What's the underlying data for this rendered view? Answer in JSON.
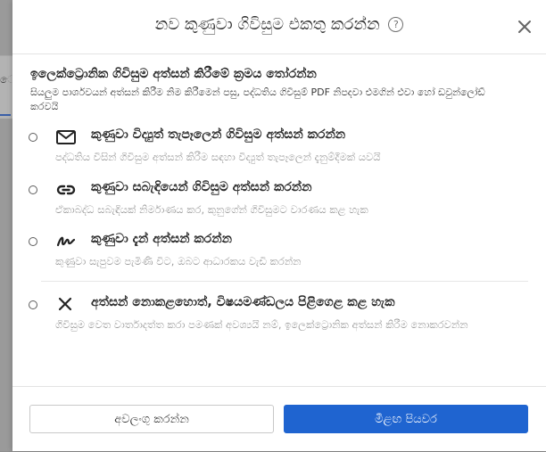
{
  "background": {
    "partial_mark": "ෙ"
  },
  "dialog": {
    "title": "නව කුණුවා ගිවිසුම එකතු කරන්න",
    "help_symbol": "?",
    "section": {
      "title": "ඉලෙක්ට්‍රොනික ගිවිසුම අත්සන් කිරීමේ ක්‍රමය තෝරන්න",
      "description": "සියලුම පාර්ශවයන් අත්සන් කිරීම නිම කිරීමෙන් පසු, පද්ධතිය ගිවිසුම් PDF නිපදවා එමගින් එවා හෝ ඩවුන්ලෝඩ් කරවයි"
    },
    "options": [
      {
        "icon": "envelope-icon",
        "label": "කුණුවා විද්‍යුත් තැපෑලෙන් ගිවිසුම අත්සන් කරන්න",
        "description": "පද්ධතිය විසින් ගිවිසුම අත්සන් කිරීම සඳහා විද්‍යුත් තැපෑලෙන් දැනුම්දීමක් යවයි"
      },
      {
        "icon": "link-icon",
        "label": "කුණුවා සබැඳියෙන් ගිවිසුම අත්සන් කරන්න",
        "description": "ඒකාබද්ධ සබැඳියක් නිර්මාණය කර, කුනුගේන් ගිවිසුමට වාරණය කළ හැක"
      },
      {
        "icon": "signature-icon",
        "label": "කුණුවා දැන් අත්සන් කරන්න",
        "description": "කුණුවා සැපුවම පැමිණි විට, ඔබට ආධාරකය වැඩි කරන්න"
      },
      {
        "icon": "x-icon",
        "label": "අත්සන් නොකළහොත්, විෂයමණ්ඩලය පිළිගෙළ කළ හැක",
        "description": "ගිවිසුම වෙත වාර්තාදත්ත කරා පමණක් අවශ්‍යයි නම්, ඉලෙක්ට්‍රොනික අත්සන් කිරීම නොකරවන්න"
      }
    ],
    "buttons": {
      "cancel": "අවලංගු කරන්න",
      "next": "මීළඟ පියවර"
    },
    "colors": {
      "primary": "#1f64d0",
      "muted_text": "#9a9a9a"
    }
  }
}
